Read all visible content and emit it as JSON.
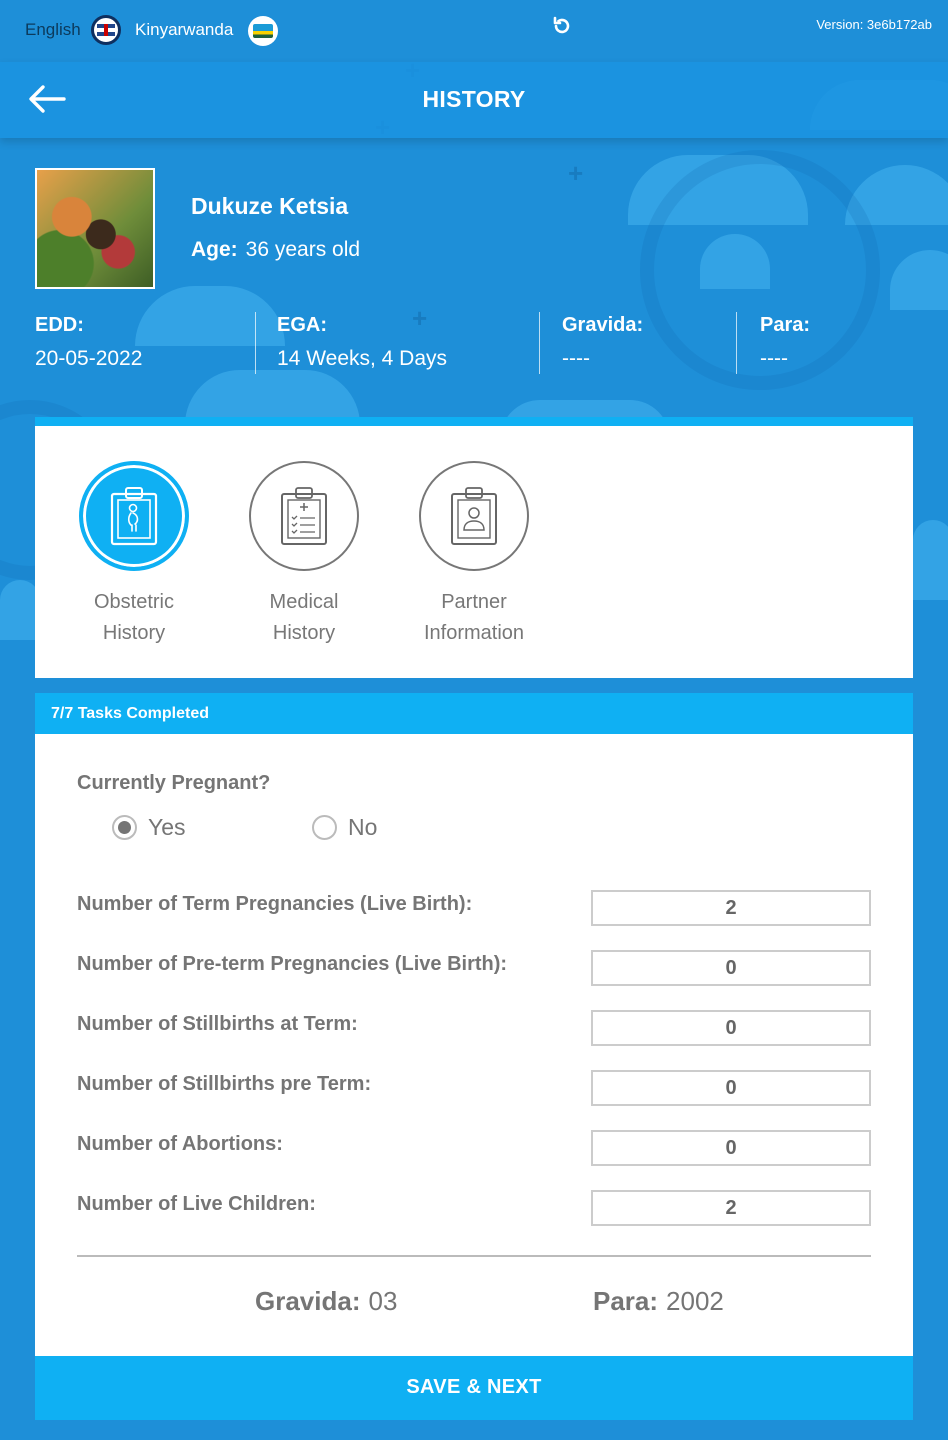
{
  "topbar": {
    "lang_english": "English",
    "lang_kinyarwanda": "Kinyarwanda",
    "version": "Version: 3e6b172ab"
  },
  "header": {
    "title": "HISTORY"
  },
  "patient": {
    "name": "Dukuze Ketsia",
    "age_label": "Age:",
    "age_value": "36 years old",
    "stats": [
      {
        "label": "EDD:",
        "value": "20-05-2022"
      },
      {
        "label": "EGA:",
        "value": "14 Weeks, 4 Days"
      },
      {
        "label": "Gravida:",
        "value": "----"
      },
      {
        "label": "Para:",
        "value": "----"
      }
    ]
  },
  "tabs": [
    {
      "line1": "Obstetric",
      "line2": "History",
      "icon": "pregnant-clipboard-icon",
      "active": true
    },
    {
      "line1": "Medical",
      "line2": "History",
      "icon": "medical-clipboard-icon",
      "active": false
    },
    {
      "line1": "Partner",
      "line2": "Information",
      "icon": "person-clipboard-icon",
      "active": false
    }
  ],
  "tasks": {
    "label": "7/7 Tasks Completed"
  },
  "form": {
    "question": "Currently Pregnant?",
    "options": [
      {
        "label": "Yes",
        "checked": true
      },
      {
        "label": "No",
        "checked": false
      }
    ],
    "rows": [
      {
        "label": "Number of Term Pregnancies (Live Birth):",
        "value": "2"
      },
      {
        "label": "Number of Pre-term Pregnancies (Live Birth):",
        "value": "0"
      },
      {
        "label": "Number of Stillbirths at Term:",
        "value": "0"
      },
      {
        "label": "Number of Stillbirths pre Term:",
        "value": "0"
      },
      {
        "label": "Number of Abortions:",
        "value": "0"
      },
      {
        "label": "Number of Live Children:",
        "value": "2"
      }
    ],
    "summary": {
      "gravida_label": "Gravida:",
      "gravida_value": "03",
      "para_label": "Para:",
      "para_value": "2002"
    }
  },
  "save_button": {
    "label": "SAVE & NEXT"
  },
  "colors": {
    "background": "#1e8fd8",
    "accent": "#0fb0f3",
    "text_gray": "#757575"
  }
}
